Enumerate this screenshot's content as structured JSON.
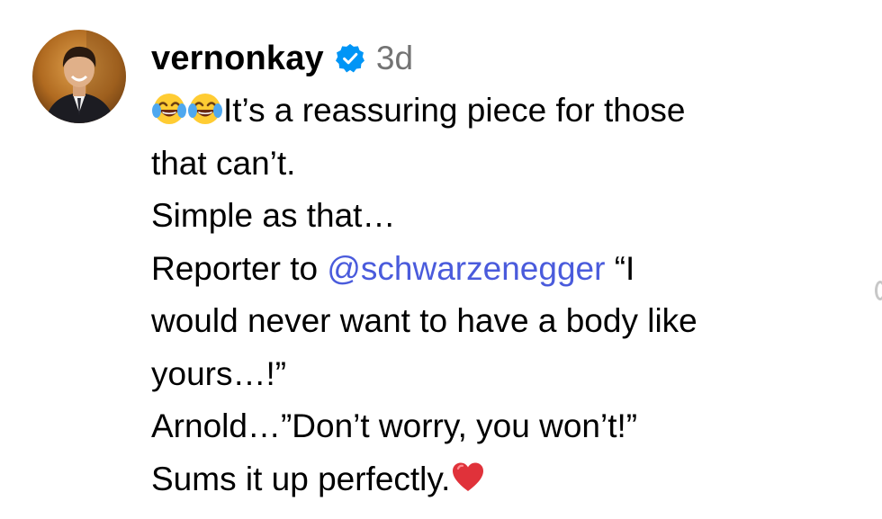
{
  "comment": {
    "username": "vernonkay",
    "verified": true,
    "time_ago": "3d",
    "avatar_icon": "user-avatar-photo",
    "emoji_laugh": "face-with-tears-of-joy",
    "emoji_heart": "red-heart",
    "lines": {
      "l1_text": "It’s a reassuring piece for those",
      "l2_text": "that can’t.",
      "l3_text": "Simple as that…",
      "l4_before": "Reporter to ",
      "l4_mention": "@schwarzenegger",
      "l4_after": " “I",
      "l5_text": "would never want to have a body like",
      "l6_text": "yours…!”",
      "l7_text": "Arnold…”Don’t worry, you won’t!”",
      "l8_text": "Sums it up perfectly."
    }
  },
  "colors": {
    "username": "#000000",
    "time": "#737373",
    "mention": "#4a5bdc",
    "verified_badge": "#0095f6",
    "heart": "#e0323a",
    "emoji_face": "#ffcc33"
  }
}
